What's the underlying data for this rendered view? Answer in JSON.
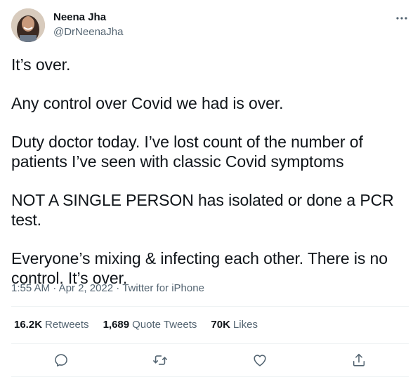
{
  "author": {
    "name": "Neena Jha",
    "handle": "@DrNeenaJha"
  },
  "tweet": {
    "paragraphs": [
      "It’s over.",
      "Any control over Covid we had is over.",
      "Duty doctor today. I’ve lost count of the number of patients I’ve seen with classic Covid symptoms",
      "NOT A SINGLE PERSON has isolated or done a PCR test.",
      "Everyone’s mixing & infecting each other. There is no control. It’s over."
    ],
    "time": "1:55 AM",
    "date": "Apr 2, 2022",
    "source": "Twitter for iPhone",
    "separator": "·"
  },
  "stats": {
    "retweets_count": "16.2K",
    "retweets_label": "Retweets",
    "quotes_count": "1,689",
    "quotes_label": "Quote Tweets",
    "likes_count": "70K",
    "likes_label": "Likes"
  },
  "icons": {
    "more": "more-horizontal-icon",
    "reply": "reply-icon",
    "retweet": "retweet-icon",
    "like": "like-icon",
    "share": "share-icon"
  },
  "colors": {
    "text": "#0f1419",
    "secondary": "#536471",
    "divider": "#eff3f4"
  }
}
